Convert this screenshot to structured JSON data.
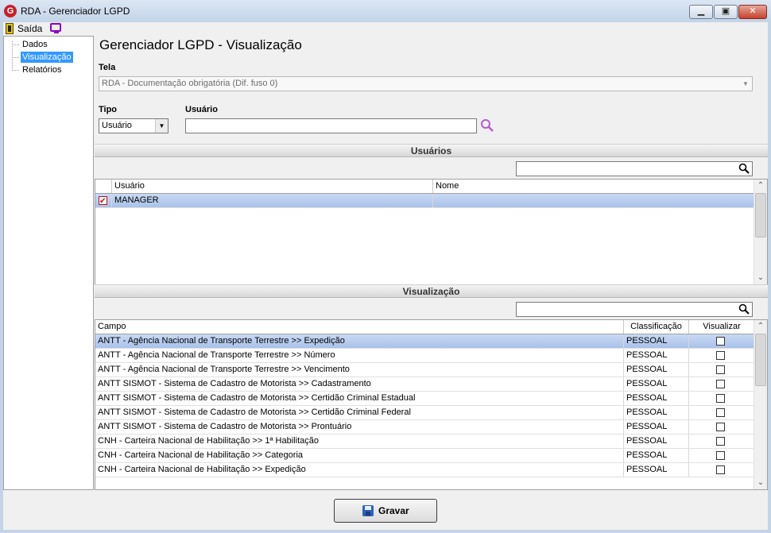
{
  "window": {
    "title": "RDA - Gerenciador LGPD",
    "icon": "G",
    "buttons": {
      "minimize": "▁",
      "maximize": "▣",
      "close": "✕"
    }
  },
  "menu": {
    "exit_label": "Saída"
  },
  "tree": {
    "items": [
      {
        "label": "Dados"
      },
      {
        "label": "Visualização",
        "selected": true
      },
      {
        "label": "Relatórios"
      }
    ]
  },
  "page": {
    "title": "Gerenciador LGPD - Visualização"
  },
  "form": {
    "tela_label": "Tela",
    "tela_value": "RDA - Documentação obrigatória (Dif. fuso 0)",
    "tipo_label": "Tipo",
    "tipo_value": "Usuário",
    "usuario_label": "Usuário",
    "usuario_value": ""
  },
  "users_section": {
    "header": "Usuários",
    "filter_value": "",
    "columns": {
      "user": "Usuário",
      "name": "Nome"
    },
    "rows": [
      {
        "user": "MANAGER",
        "name": "",
        "checked": true
      }
    ]
  },
  "view_section": {
    "header": "Visualização",
    "filter_value": "",
    "columns": {
      "field": "Campo",
      "classification": "Classificação",
      "view": "Visualizar"
    },
    "rows": [
      {
        "field": "ANTT - Agência Nacional de Transporte Terrestre >> Expedição",
        "classification": "PESSOAL",
        "view": false
      },
      {
        "field": "ANTT - Agência Nacional de Transporte Terrestre >> Número",
        "classification": "PESSOAL",
        "view": false
      },
      {
        "field": "ANTT - Agência Nacional de Transporte Terrestre >> Vencimento",
        "classification": "PESSOAL",
        "view": false
      },
      {
        "field": "ANTT SISMOT - Sistema de Cadastro de Motorista >> Cadastramento",
        "classification": "PESSOAL",
        "view": false
      },
      {
        "field": "ANTT SISMOT - Sistema de Cadastro de Motorista >> Certidão Criminal Estadual",
        "classification": "PESSOAL",
        "view": false
      },
      {
        "field": "ANTT SISMOT - Sistema de Cadastro de Motorista >> Certidão Criminal Federal",
        "classification": "PESSOAL",
        "view": false
      },
      {
        "field": "ANTT SISMOT - Sistema de Cadastro de Motorista >> Prontuário",
        "classification": "PESSOAL",
        "view": false
      },
      {
        "field": "CNH - Carteira Nacional de Habilitação >> 1ª Habilitação",
        "classification": "PESSOAL",
        "view": false
      },
      {
        "field": "CNH - Carteira Nacional de Habilitação >> Categoria",
        "classification": "PESSOAL",
        "view": false
      },
      {
        "field": "CNH - Carteira Nacional de Habilitação >> Expedição",
        "classification": "PESSOAL",
        "view": false
      }
    ]
  },
  "footer": {
    "save_label": "Gravar"
  },
  "colors": {
    "selection": "#3399ff",
    "row_selected": "#b4c9ee",
    "search_icon": "#b35ccf",
    "save_icon": "#2b63b8"
  }
}
